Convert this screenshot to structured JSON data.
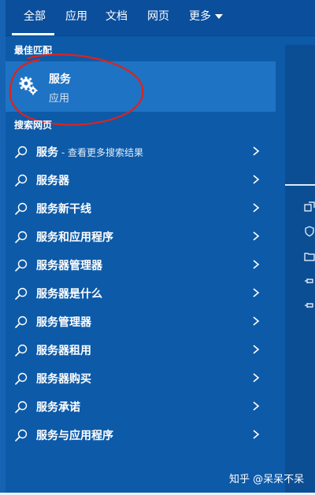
{
  "tabs": [
    {
      "label": "全部",
      "active": true
    },
    {
      "label": "应用"
    },
    {
      "label": "文档"
    },
    {
      "label": "网页"
    },
    {
      "label": "更多"
    }
  ],
  "best_match": {
    "section_label": "最佳匹配",
    "title": "服务",
    "subtitle": "应用",
    "icon": "gear-icon"
  },
  "web_search": {
    "section_label": "搜索网页",
    "first_suffix": " - 查看更多搜索结果",
    "items": [
      "服务",
      "服务器",
      "服务新干线",
      "服务和应用程序",
      "服务器管理器",
      "服务器是什么",
      "服务管理器",
      "服务器租用",
      "服务器购买",
      "服务承诺",
      "服务与应用程序"
    ]
  },
  "preview_icons": [
    "open-icon",
    "pin-start-icon",
    "folder-icon",
    "pin-taskbar-icon",
    "pin-icon"
  ],
  "watermark": "知乎 @呆呆不呆",
  "colors": {
    "background": "#0d5aa8",
    "selected": "#1e73c4",
    "annotation": "#e0221b"
  }
}
